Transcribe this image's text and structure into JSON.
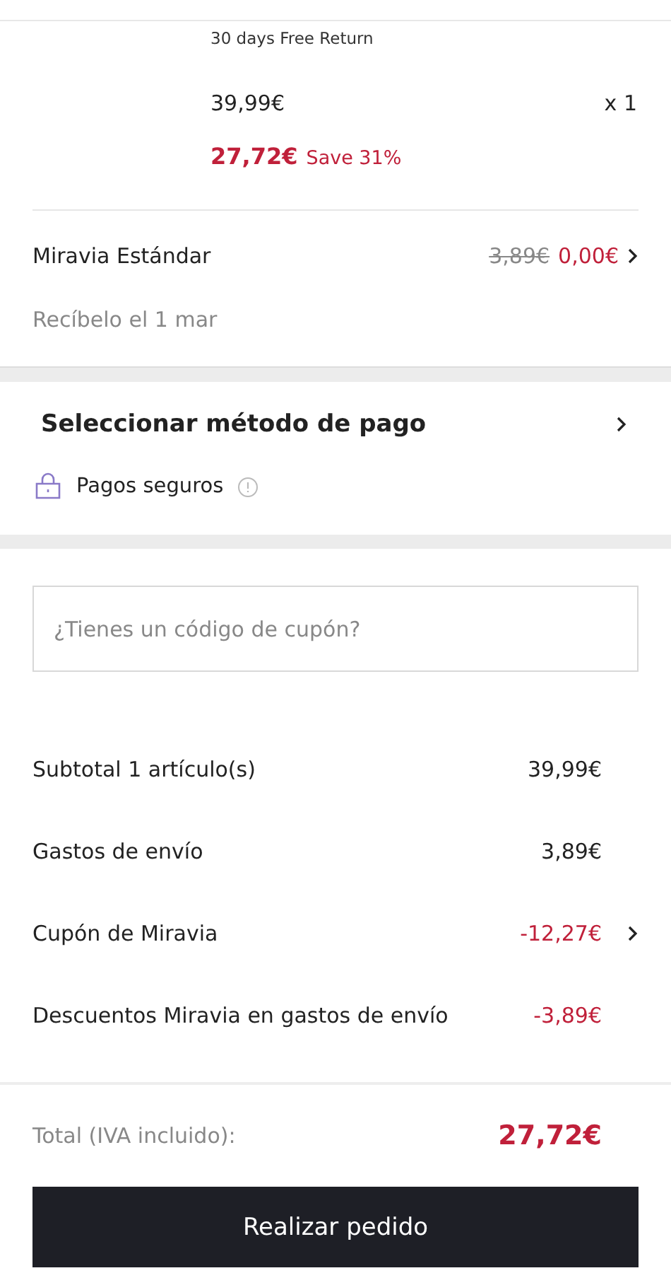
{
  "product": {
    "return_policy": "30 days Free Return",
    "original_price": "39,99€",
    "quantity": "x 1",
    "sale_price": "27,72€",
    "savings": "Save 31%"
  },
  "shipping": {
    "method": "Miravia Estándar",
    "old_price": "3,89€",
    "price": "0,00€",
    "delivery": "Recíbelo el 1 mar"
  },
  "payment": {
    "title": "Seleccionar método de pago",
    "secure_label": "Pagos seguros"
  },
  "coupon": {
    "placeholder": "¿Tienes un código de cupón?"
  },
  "summary": [
    {
      "label": "Subtotal 1 artículo(s)",
      "value": "39,99€",
      "kind": "normal",
      "has_arrow": false
    },
    {
      "label": "Gastos de envío",
      "value": "3,89€",
      "kind": "normal",
      "has_arrow": false
    },
    {
      "label": "Cupón de Miravia",
      "value": "-12,27€",
      "kind": "discount",
      "has_arrow": true
    },
    {
      "label": "Descuentos Miravia en gastos de envío",
      "value": "-3,89€",
      "kind": "discount",
      "has_arrow": false
    }
  ],
  "total": {
    "label": "Total (IVA incluido):",
    "value": "27,72€"
  },
  "place_order_button": "Realizar pedido"
}
